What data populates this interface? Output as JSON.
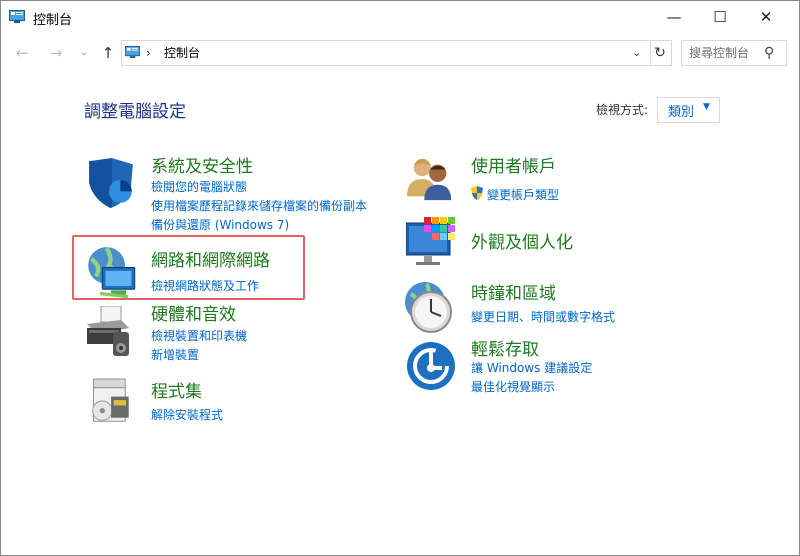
{
  "window": {
    "title": "控制台",
    "buttons": {
      "minimize": "—",
      "maximize": "☐",
      "close": "✕"
    }
  },
  "navigation": {
    "back": "←",
    "forward": "→",
    "recent": "⌄",
    "up": "↑",
    "breadcrumb_separator": "›",
    "address": "控制台",
    "address_dropdown": "⌄",
    "refresh": "↻",
    "search_placeholder": "搜尋控制台",
    "search_icon": "⚲"
  },
  "main": {
    "heading": "調整電腦設定",
    "view_by_label": "檢視方式:",
    "view_by_value": "類別",
    "view_by_caret": "▼"
  },
  "categories": {
    "security": {
      "title": "系統及安全性",
      "icon": "shield-icon",
      "links": [
        "檢閱您的電腦狀態",
        "使用檔案歷程記錄來儲存檔案的備份副本",
        "備份與還原 (Windows 7)"
      ]
    },
    "network": {
      "title": "網路和網際網路",
      "icon": "network-icon",
      "links": [
        "檢視網路狀態及工作"
      ]
    },
    "hardware": {
      "title": "硬體和音效",
      "icon": "printer-icon",
      "links": [
        "檢視裝置和印表機",
        "新增裝置"
      ]
    },
    "programs": {
      "title": "程式集",
      "icon": "programs-icon",
      "links": [
        "解除安裝程式"
      ]
    },
    "accounts": {
      "title": "使用者帳戶",
      "icon": "users-icon",
      "links": [
        "變更帳戶類型"
      ]
    },
    "appearance": {
      "title": "外觀及個人化",
      "icon": "appearance-icon",
      "links": []
    },
    "clock": {
      "title": "時鐘和區域",
      "icon": "clock-icon",
      "links": [
        "變更日期、時間或數字格式"
      ]
    },
    "ease": {
      "title": "輕鬆存取",
      "icon": "ease-of-access-icon",
      "links": [
        "讓 Windows 建議設定",
        "最佳化視覺顯示"
      ]
    }
  },
  "colors": {
    "category_title": "#1e7a1e",
    "link": "#0066cc",
    "heading": "#1e3287",
    "highlight": "#e66262"
  }
}
